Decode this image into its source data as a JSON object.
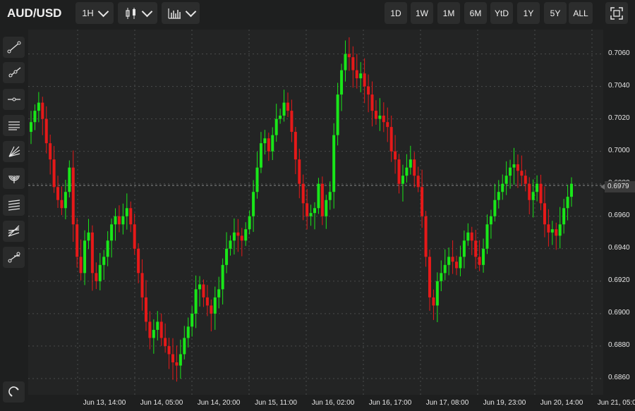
{
  "header": {
    "symbol": "AUD/USD",
    "interval": "1H",
    "chart_type_icon": "candlestick-icon",
    "indicators_icon": "indicator-chart-icon",
    "ranges": [
      "1D",
      "1W",
      "1M",
      "6M",
      "YtD",
      "1Y",
      "5Y",
      "ALL"
    ],
    "fullscreen_icon": "fullscreen-icon"
  },
  "toolbar": {
    "tools": [
      "trend-line-icon",
      "ray-icon",
      "horizontal-line-icon",
      "parallel-channel-icon",
      "fib-fan-icon",
      "fib-arcs-icon",
      "fib-retracement-icon",
      "gann-fan-icon",
      "measure-icon"
    ],
    "bottom_tool": "magnet-icon"
  },
  "colors": {
    "up": "#19e619",
    "down": "#e61919",
    "grid": "#4a4b4b",
    "background": "#232424"
  },
  "current_price": "0.6979",
  "chart_data": {
    "type": "candlestick",
    "y_ticks": [
      "0.6860",
      "0.6880",
      "0.6900",
      "0.6920",
      "0.6940",
      "0.6960",
      "0.6980",
      "0.7000",
      "0.7020",
      "0.7040",
      "0.7060"
    ],
    "x_ticks": [
      "Jun 13, 14:00",
      "Jun 14, 05:00",
      "Jun 14, 20:00",
      "Jun 15, 11:00",
      "Jun 16, 02:00",
      "Jun 16, 17:00",
      "Jun 17, 08:00",
      "Jun 19, 23:00",
      "Jun 20, 14:00",
      "Jun 21, 05:00"
    ],
    "ylim": [
      0.685,
      0.7075
    ],
    "closes": [
      0.7018,
      0.7025,
      0.703,
      0.702,
      0.7005,
      0.6995,
      0.6978,
      0.697,
      0.6965,
      0.6975,
      0.699,
      0.6955,
      0.6935,
      0.6925,
      0.6945,
      0.695,
      0.6925,
      0.692,
      0.693,
      0.6935,
      0.6945,
      0.6955,
      0.696,
      0.6955,
      0.696,
      0.6965,
      0.6955,
      0.694,
      0.6925,
      0.691,
      0.6895,
      0.6885,
      0.689,
      0.6895,
      0.6885,
      0.688,
      0.6875,
      0.687,
      0.6868,
      0.6875,
      0.6885,
      0.6892,
      0.69,
      0.6915,
      0.6918,
      0.691,
      0.6905,
      0.69,
      0.691,
      0.6915,
      0.693,
      0.694,
      0.6945,
      0.695,
      0.6948,
      0.6945,
      0.6952,
      0.696,
      0.6975,
      0.699,
      0.7005,
      0.7008,
      0.7,
      0.701,
      0.702,
      0.7022,
      0.703,
      0.7025,
      0.7012,
      0.6995,
      0.698,
      0.6968,
      0.696,
      0.6962,
      0.6965,
      0.698,
      0.696,
      0.697,
      0.6975,
      0.701,
      0.7035,
      0.705,
      0.706,
      0.7058,
      0.705,
      0.7045,
      0.7048,
      0.704,
      0.7035,
      0.7025,
      0.702,
      0.7022,
      0.7018,
      0.7015,
      0.7,
      0.6995,
      0.698,
      0.6985,
      0.699,
      0.6995,
      0.6985,
      0.6978,
      0.696,
      0.6935,
      0.691,
      0.6905,
      0.692,
      0.6925,
      0.693,
      0.6935,
      0.6932,
      0.6928,
      0.6935,
      0.6945,
      0.695,
      0.6945,
      0.6935,
      0.693,
      0.694,
      0.6955,
      0.696,
      0.697,
      0.6975,
      0.698,
      0.6985,
      0.699,
      0.6992,
      0.6988,
      0.6985,
      0.698,
      0.697,
      0.6975,
      0.698,
      0.6968,
      0.6955,
      0.695,
      0.6952,
      0.6948,
      0.6955,
      0.6965,
      0.6972,
      0.698
    ]
  }
}
